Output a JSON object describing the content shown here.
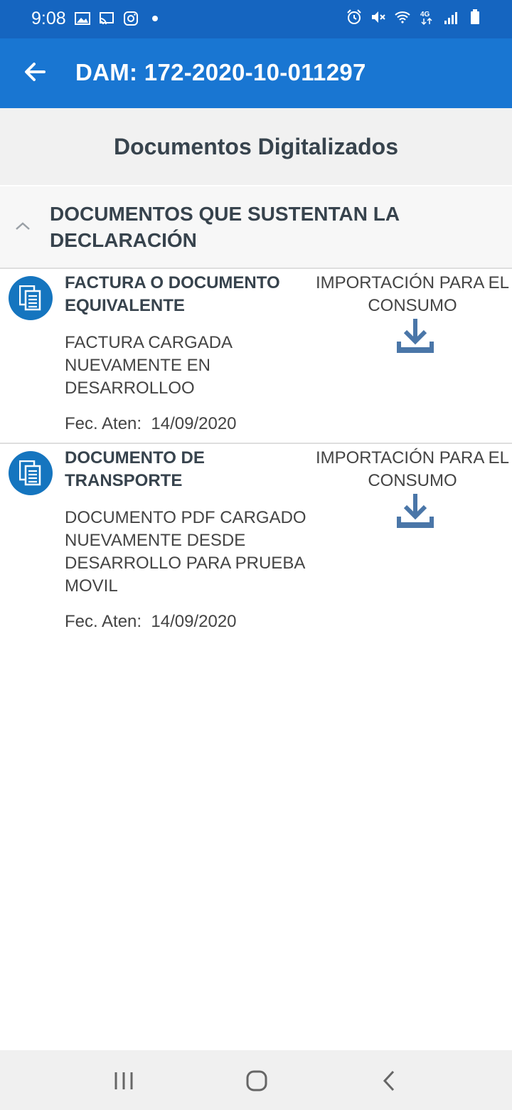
{
  "status_bar": {
    "time": "9:08",
    "left_icons": [
      "image-icon",
      "cast-icon",
      "instagram-icon",
      "dot-icon"
    ],
    "right_icons": [
      "alarm-icon",
      "mute-icon",
      "wifi-icon",
      "4g-icon",
      "signal-icon",
      "battery-icon"
    ],
    "network": "4G"
  },
  "app_bar": {
    "title": "DAM: 172-2020-10-011297",
    "color": "#1976d2"
  },
  "page": {
    "section_title": "Documentos Digitalizados"
  },
  "group": {
    "title": "DOCUMENTOS QUE SUSTENTAN LA DECLARACIÓN",
    "expanded": true
  },
  "documents": [
    {
      "title": "FACTURA O DOCUMENTO EQUIVALENTE",
      "description": "FACTURA CARGADA NUEVAMENTE EN DESARROLLOO",
      "date_label": "Fec. Aten:",
      "date": "14/09/2020",
      "type": "IMPORTACIÓN PARA EL CONSUMO"
    },
    {
      "title": "DOCUMENTO DE TRANSPORTE",
      "description": "DOCUMENTO PDF CARGADO NUEVAMENTE DESDE DESARROLLO PARA PRUEBA MOVIL",
      "date_label": "Fec. Aten:",
      "date": "14/09/2020",
      "type": "IMPORTACIÓN PARA EL CONSUMO"
    }
  ],
  "colors": {
    "status_bar": "#1565c0",
    "accent": "#1575bf",
    "download": "#4a76a8",
    "header_text": "#37434d"
  }
}
